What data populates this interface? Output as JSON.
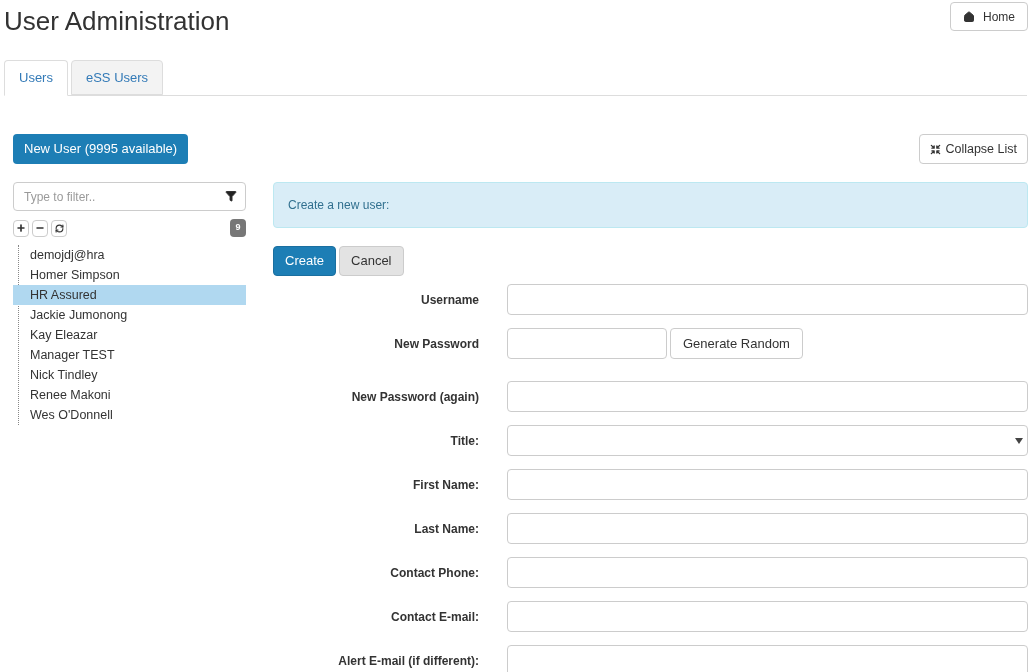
{
  "page_title": "User Administration",
  "home_button": {
    "label": "Home"
  },
  "tabs": [
    {
      "label": "Users",
      "selected": true
    },
    {
      "label": "eSS Users",
      "selected": false
    }
  ],
  "new_user_button": {
    "label": "New User (9995 available)"
  },
  "collapse_button": {
    "label": "Collapse List"
  },
  "filter": {
    "placeholder": "Type to filter.."
  },
  "user_count": "9",
  "users": [
    {
      "name": "demojdj@hra",
      "selected": false
    },
    {
      "name": "Homer Simpson",
      "selected": false
    },
    {
      "name": "HR Assured",
      "selected": true
    },
    {
      "name": "Jackie Jumonong",
      "selected": false
    },
    {
      "name": "Kay Eleazar",
      "selected": false
    },
    {
      "name": "Manager TEST",
      "selected": false
    },
    {
      "name": "Nick Tindley",
      "selected": false
    },
    {
      "name": "Renee Makoni",
      "selected": false
    },
    {
      "name": "Wes O'Donnell",
      "selected": false
    }
  ],
  "info_message": "Create a new user:",
  "actions": [
    {
      "label": "Create",
      "kind": "primary"
    },
    {
      "label": "Cancel",
      "kind": "secondary"
    }
  ],
  "form_fields": [
    {
      "label": "Username",
      "kind": "text"
    },
    {
      "label": "New Password",
      "kind": "password_generate",
      "button": "Generate Random"
    },
    {
      "label": "New Password (again)",
      "kind": "text"
    },
    {
      "label": "Title:",
      "kind": "select"
    },
    {
      "label": "First Name:",
      "kind": "text"
    },
    {
      "label": "Last Name:",
      "kind": "text"
    },
    {
      "label": "Contact Phone:",
      "kind": "text"
    },
    {
      "label": "Contact E-mail:",
      "kind": "text"
    },
    {
      "label": "Alert E-mail (if different):",
      "kind": "text"
    }
  ]
}
